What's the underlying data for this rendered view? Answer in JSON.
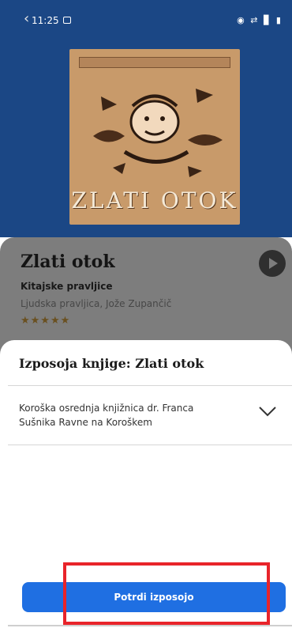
{
  "status_bar": {
    "time": "11:25",
    "icons": "◉ ⇄ ▊ ▮"
  },
  "book": {
    "cover_caption": "ZLATI OTOK",
    "title": "Zlati otok",
    "subtitle": "Kitajske pravljice",
    "authors": "Ljudska pravljica, Jože Zupančič",
    "rating": 5,
    "stars": "★★★★★"
  },
  "sheet": {
    "title": "Izposoja knjige: Zlati otok",
    "library": "Koroška osrednja knjižnica dr. Franca Sušnika Ravne na Koroškem",
    "confirm_label": "Potrdi izposojo"
  },
  "colors": {
    "hero_bg": "#1b4785",
    "primary_button": "#1f6fe2",
    "highlight_border": "#e8242a",
    "info_panel_dimmed": "#7d7d7d"
  }
}
